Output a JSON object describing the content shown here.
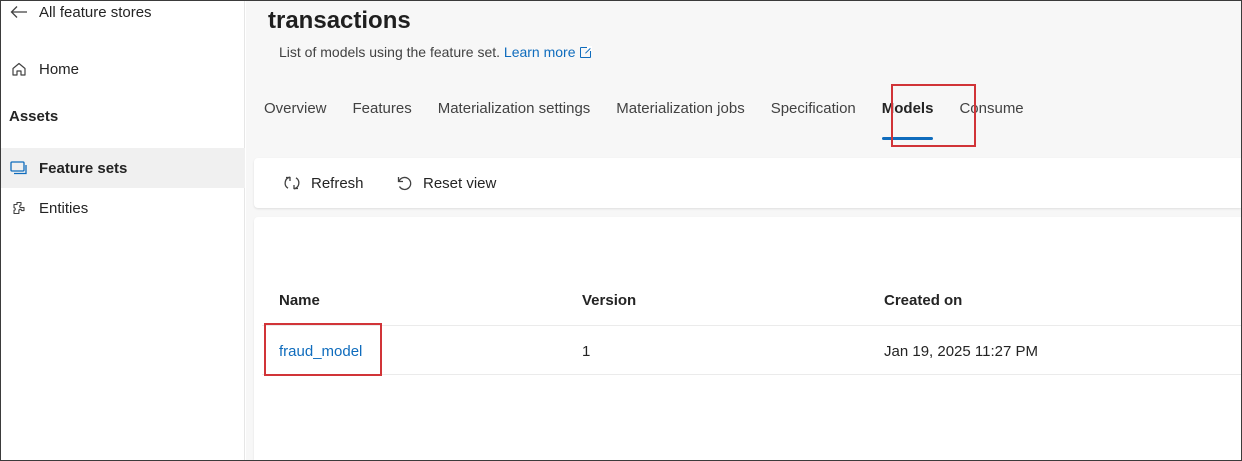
{
  "sidebar": {
    "back_label": "All feature stores",
    "home_label": "Home",
    "assets_heading": "Assets",
    "items": [
      {
        "label": "Feature sets",
        "icon": "feature-sets-icon",
        "selected": true
      },
      {
        "label": "Entities",
        "icon": "entities-icon",
        "selected": false
      }
    ]
  },
  "header": {
    "title": "transactions",
    "subtitle": "List of models using the feature set.",
    "learn_more": "Learn more"
  },
  "tabs": [
    {
      "label": "Overview",
      "active": false
    },
    {
      "label": "Features",
      "active": false
    },
    {
      "label": "Materialization settings",
      "active": false
    },
    {
      "label": "Materialization jobs",
      "active": false
    },
    {
      "label": "Specification",
      "active": false
    },
    {
      "label": "Models",
      "active": true
    },
    {
      "label": "Consume",
      "active": false
    }
  ],
  "toolbar": {
    "refresh_label": "Refresh",
    "reset_label": "Reset view"
  },
  "table": {
    "columns": [
      "Name",
      "Version",
      "Created on"
    ],
    "rows": [
      {
        "name": "fraud_model",
        "version": "1",
        "created_on": "Jan 19, 2025 11:27 PM"
      }
    ]
  },
  "colors": {
    "accent": "#0f6cbd",
    "highlight_box": "#d13438"
  }
}
